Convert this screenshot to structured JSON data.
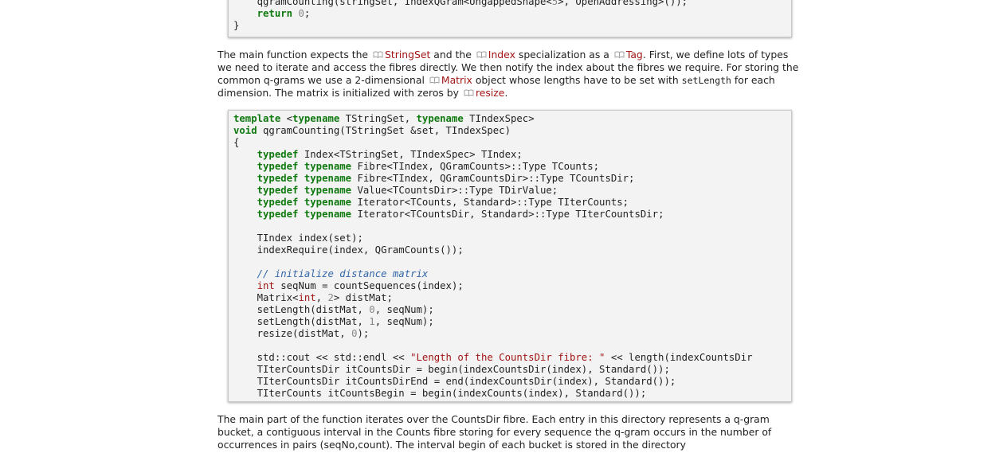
{
  "code_block_top": {
    "lines": [
      "    qgramCounting(stringSet, IndexQGram<UngappedShape<5>, OpenAddressing>());",
      "    return 0;",
      "}"
    ]
  },
  "paragraph_1": {
    "t1": "The main function expects the ",
    "link_stringset": "StringSet",
    "t2": " and the ",
    "link_index": "Index",
    "t3": " specialization as a ",
    "link_tag": "Tag",
    "t4": ". First, we define lots of types we need to iterate and access the fibres directly. We then notify the index about the fibres we require. For storing the common q-grams we use a 2-dimensional ",
    "link_matrix": "Matrix",
    "t5": " object whose lengths have to be set with ",
    "code_setlength": "setLength",
    "t6": " for each dimension. The matrix is initialized with zeros by ",
    "link_resize": "resize",
    "t7": "."
  },
  "code_block_main": {
    "lines": [
      "template <typename TStringSet, typename TIndexSpec>",
      "void qgramCounting(TStringSet &set, TIndexSpec)",
      "{",
      "    typedef Index<TStringSet, TIndexSpec> TIndex;",
      "    typedef typename Fibre<TIndex, QGramCounts>::Type TCounts;",
      "    typedef typename Fibre<TIndex, QGramCountsDir>::Type TCountsDir;",
      "    typedef typename Value<TCountsDir>::Type TDirValue;",
      "    typedef typename Iterator<TCounts, Standard>::Type TIterCounts;",
      "    typedef typename Iterator<TCountsDir, Standard>::Type TIterCountsDir;",
      "",
      "    TIndex index(set);",
      "    indexRequire(index, QGramCounts());",
      "",
      "    // initialize distance matrix",
      "    int seqNum = countSequences(index);",
      "    Matrix<int, 2> distMat;",
      "    setLength(distMat, 0, seqNum);",
      "    setLength(distMat, 1, seqNum);",
      "    resize(distMat, 0);",
      "",
      "    std::cout << std::endl << \"Length of the CountsDir fibre: \" << length(indexCountsDir",
      "    TIterCountsDir itCountsDir = begin(indexCountsDir(index), Standard());",
      "    TIterCountsDir itCountsDirEnd = end(indexCountsDir(index), Standard());",
      "    TIterCounts itCountsBegin = begin(indexCounts(index), Standard());"
    ]
  },
  "paragraph_2": {
    "text": "The main part of the function iterates over the CountsDir fibre. Each entry in this directory represents a q-gram bucket, a contiguous interval in the Counts fibre storing for every sequence the q-gram occurs in the number of occurrences in pairs (seqNo,count). The interval begin of each bucket is stored in the directory"
  },
  "icons": {
    "doc_link_icon": "book-icon"
  },
  "colors": {
    "link": "#a31515",
    "keyword": "#0f7a0f",
    "comment": "#3366aa",
    "code_bg": "#f3f3f3"
  }
}
